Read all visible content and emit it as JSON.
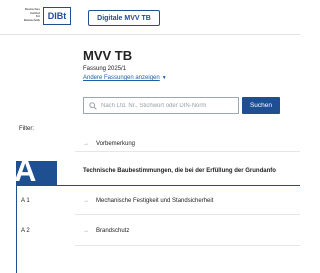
{
  "header": {
    "logo_text": "Deutsches Institut für Bautechnik",
    "logo_mark": "DIBt",
    "app_button_label": "Digitale MVV TB"
  },
  "page": {
    "title": "MVV TB",
    "edition": "Fassung 2025/1",
    "other_versions_label": "Andere Fassungen anzeigen"
  },
  "search": {
    "placeholder": "Nach Lfd. Nr., Stichwort oder DIN-Norm",
    "button_label": "Suchen"
  },
  "filter": {
    "label": "Filter:"
  },
  "toc": {
    "preamble": "Vorbemerkung",
    "sections": [
      {
        "letter": "A",
        "title": "Technische Baubestimmungen, die bei der Erfüllung der Grundanfo",
        "items": [
          {
            "code": "A 1",
            "label": "Mechanische Festigkeit und Standsicherheit"
          },
          {
            "code": "A 2",
            "label": "Brandschutz"
          }
        ]
      }
    ]
  },
  "colors": {
    "brand": "#1d4f91",
    "link": "#1d5fa8"
  }
}
